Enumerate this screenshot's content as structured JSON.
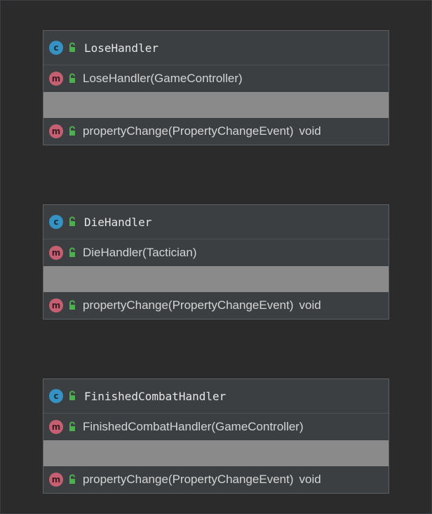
{
  "classes": [
    {
      "name": "LoseHandler",
      "icon": "class-icon",
      "icon_glyph": "c",
      "constructor": "LoseHandler(GameController)",
      "method": "propertyChange(PropertyChangeEvent)",
      "method_return": "void"
    },
    {
      "name": "DieHandler",
      "icon": "class-icon",
      "icon_glyph": "c",
      "constructor": "DieHandler(Tactician)",
      "method": "propertyChange(PropertyChangeEvent)",
      "method_return": "void"
    },
    {
      "name": "FinishedCombatHandler",
      "icon": "class-icon",
      "icon_glyph": "c",
      "constructor": "FinishedCombatHandler(GameController)",
      "method": "propertyChange(PropertyChangeEvent)",
      "method_return": "void"
    }
  ],
  "method_icon_glyph": "m",
  "colors": {
    "background": "#2b2b2b",
    "box": "#3c3f41",
    "class_icon": "#3592c4",
    "method_icon": "#c75f72",
    "public_lock": "#4caf50",
    "empty_fields": "#8a8a8a"
  }
}
